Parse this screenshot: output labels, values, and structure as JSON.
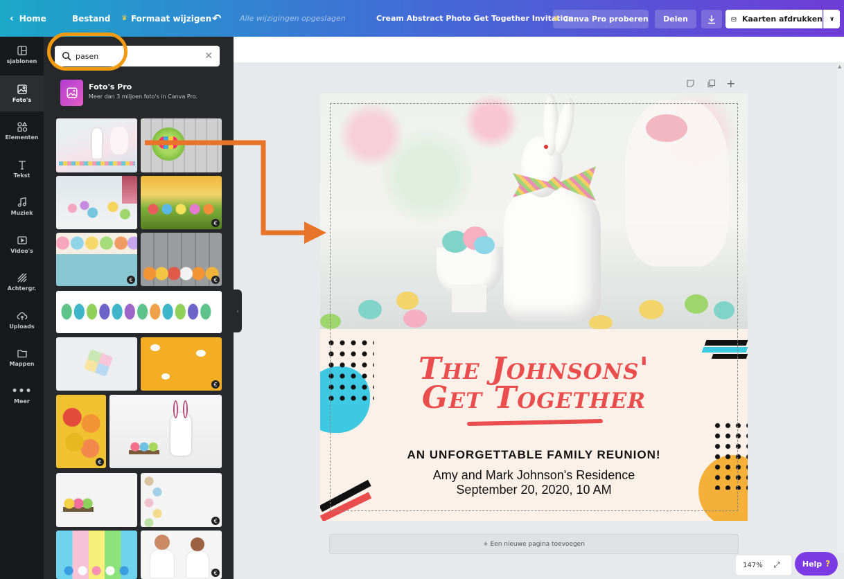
{
  "topbar": {
    "home": "Home",
    "file": "Bestand",
    "resize": "Formaat wijzigen",
    "saved_status": "Alle wijzigingen opgeslagen",
    "doc_title": "Cream Abstract Photo Get Together Invitation",
    "pro_trial": "Canva Pro proberen",
    "share": "Delen",
    "print": "Kaarten afdrukken"
  },
  "rail": {
    "items": [
      {
        "label": "sjablonen",
        "icon": "template-icon"
      },
      {
        "label": "Foto's",
        "icon": "photo-icon"
      },
      {
        "label": "Elementen",
        "icon": "shapes-icon"
      },
      {
        "label": "Tekst",
        "icon": "text-icon"
      },
      {
        "label": "Muziek",
        "icon": "music-icon"
      },
      {
        "label": "Video's",
        "icon": "video-icon"
      },
      {
        "label": "Achtergr.",
        "icon": "background-icon"
      },
      {
        "label": "Uploads",
        "icon": "upload-cloud-icon"
      },
      {
        "label": "Mappen",
        "icon": "folder-icon"
      },
      {
        "label": "Meer",
        "icon": "more-icon"
      }
    ]
  },
  "search": {
    "value": "pasen"
  },
  "promo": {
    "title": "Foto's Pro",
    "subtitle": "Meer dan 3 miljoen foto's in Canva Pro."
  },
  "design": {
    "heading_line1": "The Johnsons'",
    "heading_line2": "Get Together",
    "subheading": "AN UNFORGETTABLE FAMILY REUNION!",
    "venue": "Amy and Mark Johnson's Residence",
    "date": "September 20, 2020, 10 AM"
  },
  "add_page": "+ Een nieuwe pagina toevoegen",
  "zoom": "147%",
  "help": "Help",
  "colors": {
    "accent": "#7c3ae4",
    "highlight": "#f19a10",
    "arrow": "#e8742a",
    "heading": "#ea4d4d"
  }
}
